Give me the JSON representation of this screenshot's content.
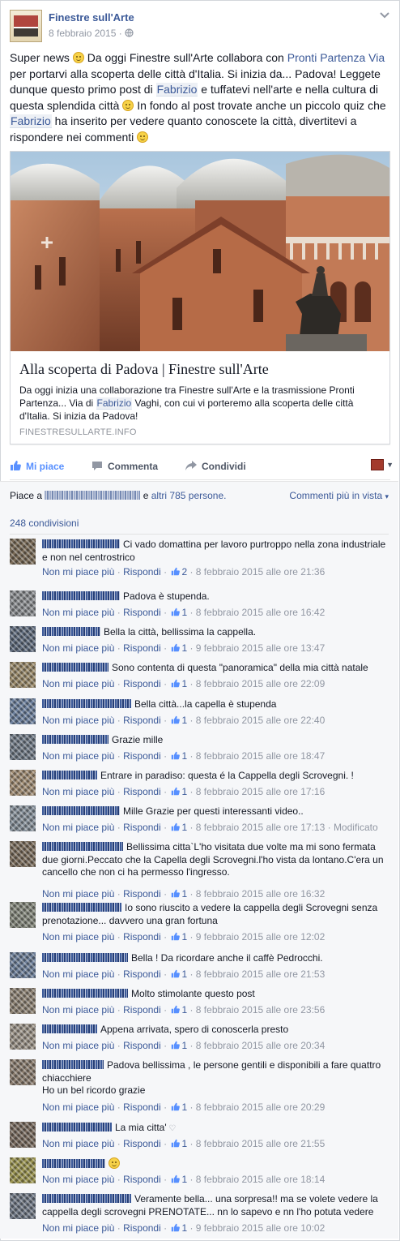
{
  "post": {
    "page_name": "Finestre sull'Arte",
    "date": "8 febbraio 2015",
    "meta_sep": "·",
    "text": {
      "p1": "Super news ",
      "p2": " Da oggi Finestre sull'Arte collabora con ",
      "link1": "Pronti Partenza Via",
      "p3": " per portarvi alla scoperta delle città d'Italia. Si inizia da... Padova! Leggete dunque questo primo post di ",
      "tag1": "Fabrizio",
      "p4": " e tuffatevi nell'arte e nella cultura di questa splendida città ",
      "p5": " In fondo al post trovate anche un piccolo quiz che ",
      "tag2": "Fabrizio",
      "p6": " ha inserito per vedere quanto conoscete la città, divertitevi a rispondere nei commenti "
    }
  },
  "card": {
    "title": "Alla scoperta di Padova | Finestre sull'Arte",
    "desc_before": "Da oggi inizia una collaborazione tra Finestre sull'Arte e la trasmissione Pronti Partenza... Via di ",
    "desc_tag": "Fabrizio",
    "desc_after": " Vaghi, con cui vi porteremo alla scoperta delle città d'Italia. Si inizia da Padova!",
    "source": "FINESTRESULLARTE.INFO"
  },
  "actions": {
    "like": "Mi piace",
    "comment": "Commenta",
    "share": "Condividi"
  },
  "social": {
    "likes_prefix": "Piace a",
    "likes_and": "e",
    "likes_others": "altri 785 persone.",
    "more_comments": "Commenti più in vista",
    "more_caret": "▾",
    "shares": "248 condivisioni"
  },
  "comment_ui": {
    "unlike": "Non mi piace più",
    "reply": "Rispondi",
    "dot": "·"
  },
  "comments": [
    {
      "text": "Ci vado domattina per lavoro purtroppo nella zona industriale e non nel centrostrico",
      "likes": "2",
      "time": "8 febbraio 2015 alle ore 21:36"
    },
    {
      "text": "Padova è stupenda.",
      "likes": "1",
      "time": "8 febbraio 2015 alle ore 16:42"
    },
    {
      "text": "Bella la città, bellissima la cappella.",
      "likes": "1",
      "time": "9 febbraio 2015 alle ore 13:47"
    },
    {
      "text": "Sono contenta di questa \"panoramica\" della mia città natale",
      "likes": "1",
      "time": "8 febbraio 2015 alle ore 22:09"
    },
    {
      "text": "Bella città...la capella è stupenda",
      "likes": "1",
      "time": "8 febbraio 2015 alle ore 22:40"
    },
    {
      "text": "Grazie mille",
      "likes": "1",
      "time": "8 febbraio 2015 alle ore 18:47"
    },
    {
      "text": "Entrare in paradiso: questa é la Cappella degli Scrovegni. !",
      "likes": "1",
      "time": "8 febbraio 2015 alle ore 17:16"
    },
    {
      "text": "Mille Grazie per questi interessanti video..",
      "likes": "1",
      "time": "8 febbraio 2015 alle ore 17:13",
      "edited": "Modificato"
    },
    {
      "text": "Bellissima citta`L'ho visitata due volte ma mi sono fermata due giorni.Peccato che la Capella degli Scrovegni.l'ho vista da lontano.C'era un cancello che non ci ha permesso l'ingresso.",
      "likes": "1",
      "time": "8 febbraio 2015 alle ore 16:32"
    },
    {
      "text": "Io sono riuscito a vedere la cappella degli Scrovegni senza prenotazione... davvero una gran fortuna",
      "likes": "1",
      "time": "9 febbraio 2015 alle ore 12:02"
    },
    {
      "text": "Bella ! Da ricordare anche il caffè Pedrocchi.",
      "likes": "1",
      "time": "8 febbraio 2015 alle ore 21:53"
    },
    {
      "text": "Molto stimolante questo post",
      "likes": "1",
      "time": "8 febbraio 2015 alle ore 23:56"
    },
    {
      "text": "Appena arrivata, spero di conoscerla presto",
      "likes": "1",
      "time": "8 febbraio 2015 alle ore 20:34"
    },
    {
      "text": "Padova bellissima , le persone gentili e disponibili a fare quattro chiacchiere",
      "text2": "Ho un bel ricordo grazie",
      "likes": "1",
      "time": "8 febbraio 2015 alle ore 20:29"
    },
    {
      "text": "La mia citta'",
      "heart": "♡",
      "likes": "1",
      "time": "8 febbraio 2015 alle ore 21:55"
    },
    {
      "text": "",
      "likes": "1",
      "time": "8 febbraio 2015 alle ore 18:14"
    },
    {
      "text": "Veramente bella... una sorpresa!! ma se volete vedere la cappella degli scrovegni PRENOTATE... nn lo sapevo e nn l'ho potuta vedere",
      "likes": "1",
      "time": "9 febbraio 2015 alle ore 10:02"
    }
  ],
  "colors": {
    "link": "#3b5998",
    "meta": "#9197a3",
    "like_active": "#5890ff"
  },
  "icons": {
    "page_logo": "finestre-logo",
    "privacy": "globe-icon",
    "like": "thumbs-up-icon",
    "comment": "speech-bubble-icon",
    "share": "share-arrow-icon"
  }
}
